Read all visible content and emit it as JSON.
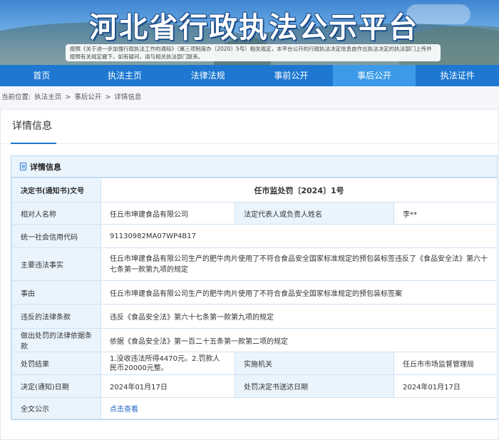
{
  "header": {
    "title": "河北省行政执法公示平台",
    "notice": "按照《关于进一步加强行政执法工作的通知》（冀三项制度办〔2020〕5号）相关规定，本平台公开的行政执法决定信息由作出执法决定的执法部门上传并按照有关规定撤下，如有疑问，请与相关执法部门联系。"
  },
  "nav": {
    "items": [
      "首页",
      "执法主页",
      "法律法规",
      "事前公开",
      "事后公开",
      "执法证件"
    ],
    "active_index": 4
  },
  "breadcrumb": {
    "prefix": "当前位置:",
    "items": [
      "执法主页",
      "事后公开",
      "详情信息"
    ],
    "separator": ">"
  },
  "panel": {
    "title": "详情信息",
    "box_title": "详情信息"
  },
  "details": {
    "decision_no_label": "决定书(通知书)文号",
    "decision_no": "任市监处罚〔2024〕1号",
    "party_label": "相对人名称",
    "party": "任丘市坤建食品有限公司",
    "legal_rep_label": "法定代表人或负责人姓名",
    "legal_rep": "李**",
    "credit_code_label": "统一社会信用代码",
    "credit_code": "91130982MA07WP4B17",
    "facts_label": "主要违法事实",
    "facts": "任丘市坤建食品有限公司生产的肥牛肉片使用了不符合食品安全国家标准规定的预包装标签违反了《食品安全法》第六十七条第一款第九项的规定",
    "cause_label": "事由",
    "cause": "任丘市坤建食品有限公司生产的肥牛肉片使用了不符合食品安全国家标准规定的预包装标签案",
    "violated_label": "违反的法律条款",
    "violated": "违反《食品安全法》第六十七条第一款第九项的规定",
    "basis_label": "做出处罚的法律依据条款",
    "basis": "依据《食品安全法》第一百二十五条第一款第二项的规定",
    "result_label": "处罚结果",
    "result": "1.没收违法所得4470元。2.罚款人民币20000元整。",
    "agency_label": "实施机关",
    "agency": "任丘市市场监督管理局",
    "decision_date_label": "决定(通知)日期",
    "decision_date": "2024年01月17日",
    "delivery_date_label": "处罚决定书送达日期",
    "delivery_date": "2024年01月17日",
    "full_text_label": "全文公示",
    "full_text_link": "点击查看"
  }
}
